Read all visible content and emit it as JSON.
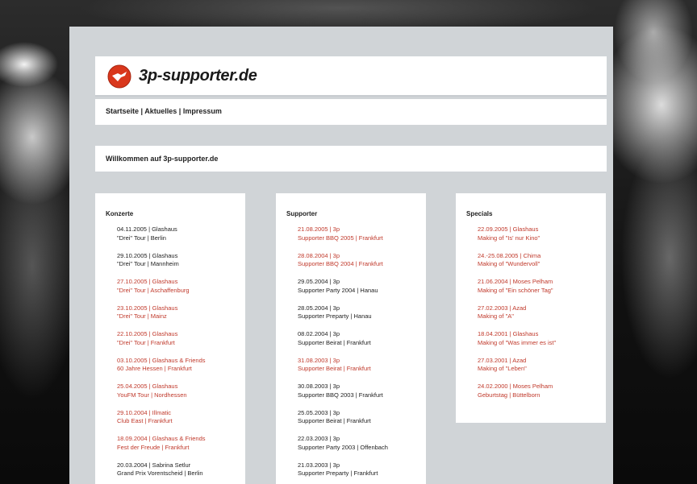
{
  "site": {
    "logo_text": "3p-supporter.de"
  },
  "nav": {
    "items": [
      "Startseite",
      "Aktuelles",
      "Impressum"
    ],
    "separator": "|"
  },
  "welcome": {
    "title": "Willkommen auf 3p-supporter.de"
  },
  "colors": {
    "link_red": "#c0392b",
    "text": "#222222",
    "container": "#d0d4d7"
  },
  "columns": [
    {
      "title": "Konzerte",
      "items": [
        {
          "line1": "04.11.2005 | Glashaus",
          "line2": "\"Drei\" Tour | Berlin",
          "color": "black"
        },
        {
          "line1": "29.10.2005 | Glashaus",
          "line2": "\"Drei\" Tour | Mannheim",
          "color": "black"
        },
        {
          "line1": "27.10.2005 | Glashaus",
          "line2": "\"Drei\" Tour | Aschaffenburg",
          "color": "red"
        },
        {
          "line1": "23.10.2005 | Glashaus",
          "line2": "\"Drei\" Tour | Mainz",
          "color": "red"
        },
        {
          "line1": "22.10.2005 | Glashaus",
          "line2": "\"Drei\" Tour | Frankfurt",
          "color": "red"
        },
        {
          "line1": "03.10.2005 | Glashaus & Friends",
          "line2": "60 Jahre Hessen | Frankfurt",
          "color": "red"
        },
        {
          "line1": "25.04.2005 | Glashaus",
          "line2": "YouFM Tour | Nordhessen",
          "color": "red"
        },
        {
          "line1": "29.10.2004 | Illmatic",
          "line2": "Club East | Frankfurt",
          "color": "red"
        },
        {
          "line1": "18.09.2004 | Glashaus & Friends",
          "line2": "Fest der Freude | Frankfurt",
          "color": "red"
        },
        {
          "line1": "20.03.2004 | Sabrina Setlur",
          "line2": "Grand Prix Vorentscheid | Berlin",
          "color": "black"
        }
      ]
    },
    {
      "title": "Supporter",
      "items": [
        {
          "line1": "21.08.2005 | 3p",
          "line2": "Supporter BBQ 2005 | Frankfurt",
          "color": "red"
        },
        {
          "line1": "28.08.2004 | 3p",
          "line2": "Supporter BBQ 2004 | Frankfurt",
          "color": "red"
        },
        {
          "line1": "29.05.2004 | 3p",
          "line2": "Supporter Party 2004 | Hanau",
          "color": "black"
        },
        {
          "line1": "28.05.2004 | 3p",
          "line2": "Supporter Preparty | Hanau",
          "color": "black"
        },
        {
          "line1": "08.02.2004 | 3p",
          "line2": "Supporter Beirat | Frankfurt",
          "color": "black"
        },
        {
          "line1": "31.08.2003 | 3p",
          "line2": "Supporter Beirat | Frankfurt",
          "color": "red"
        },
        {
          "line1": "30.08.2003 | 3p",
          "line2": "Supporter BBQ 2003 | Frankfurt",
          "color": "black"
        },
        {
          "line1": "25.05.2003 | 3p",
          "line2": "Supporter Beirat | Frankfurt",
          "color": "black"
        },
        {
          "line1": "22.03.2003 | 3p",
          "line2": "Supporter Party 2003 | Offenbach",
          "color": "black"
        },
        {
          "line1": "21.03.2003 | 3p",
          "line2": "Supporter Preparty | Frankfurt",
          "color": "black"
        }
      ]
    },
    {
      "title": "Specials",
      "items": [
        {
          "line1": "22.09.2005 | Glashaus",
          "line2": "Making of \"Is' nur Kino\"",
          "color": "red"
        },
        {
          "line1": "24.-25.08.2005 | Chima",
          "line2": "Making of \"Wundervoll\"",
          "color": "red"
        },
        {
          "line1": "21.06.2004 | Moses Pelham",
          "line2": "Making of \"Ein schöner Tag\"",
          "color": "red"
        },
        {
          "line1": "27.02.2003 | Azad",
          "line2": "Making of \"A\"",
          "color": "red"
        },
        {
          "line1": "18.04.2001 | Glashaus",
          "line2": "Making of \"Was immer es ist\"",
          "color": "red"
        },
        {
          "line1": "27.03.2001 | Azad",
          "line2": "Making of \"Leben\"",
          "color": "red"
        },
        {
          "line1": "24.02.2000 | Moses Pelham",
          "line2": "Geburtstag | Büttelborn",
          "color": "red"
        }
      ]
    }
  ]
}
